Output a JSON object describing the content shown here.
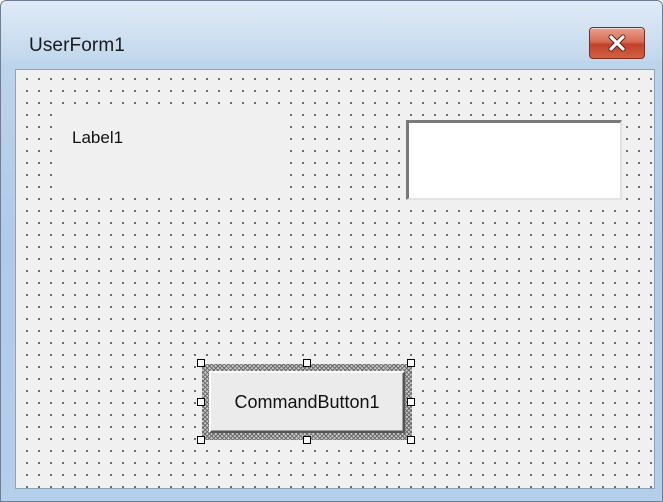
{
  "window": {
    "title": "UserForm1",
    "close_icon": "close-icon",
    "close_button_color": "#c7432b"
  },
  "form": {
    "grid_dot_color": "#3a3a3a",
    "background_color": "#f0f0f0",
    "controls": {
      "label1": {
        "text": "Label1"
      },
      "textbox1": {
        "value": ""
      },
      "command_button1": {
        "label": "CommandButton1",
        "selected": true
      }
    }
  }
}
